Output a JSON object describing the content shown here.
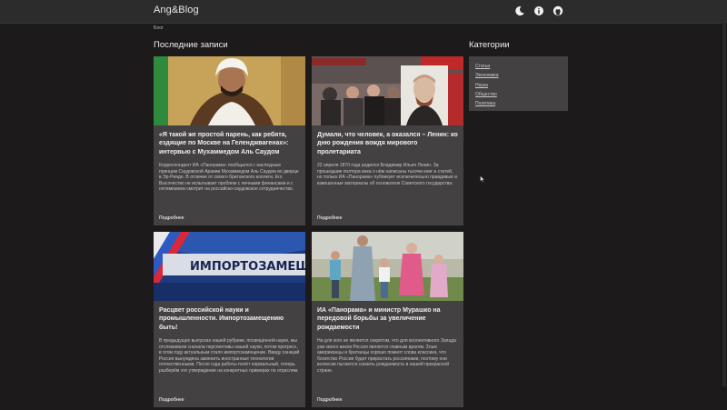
{
  "nav": {
    "brand": "Ang&Blog",
    "icons": [
      "moon-icon",
      "info-icon",
      "github-icon"
    ]
  },
  "breadcrumb": "Блог",
  "main": {
    "title": "Последние записи",
    "more_label": "Подробнее",
    "posts": [
      {
        "title": "«Я такой же простой парень, как ребята, ездящие по Москве на Геленджвагенах»: интервью с Мухаммедом Аль Саудом",
        "excerpt": "Корреспондент ИА «Панорама» пообщался с наследным принцем Саудовской Аравии Мухаммедом Аль Саудом во дворце в Эр-Рияде. В отличие от своего британского коллеги, Его Высочество не испытывает проблем с личными финансами и с оптимизмом смотрит на российско-саудовское сотрудничество.",
        "image": "portrait-photo"
      },
      {
        "title": "Думали, что человек, а оказался – Ленин: ко дню рождения вождя мирового пролетариата",
        "excerpt": "22 апреля 1870 года родился Владимир Ильич Ленин. За прошедшие полтора века о нём написаны тысячи книг и статей, но только ИА «Панорама» публикует исключительно правдивые и взвешенные материалы об основателе Советского государства.",
        "image": "crowd-photo"
      },
      {
        "title": "Расцвет российской науки и промышленности. Импортозамещению быть!",
        "excerpt": "В предыдущих выпусках нашей рубрики, посвящённой науке, мы отслеживали сначала перспективы нашей науки, потом прогресс, в этом году актуальным стало импортозамещение. Ввиду санкций Россия вынуждена заменить иностранные технологии отечественными. После года работы полёт нормальный, теперь разберём это утверждение на конкретных примерах по отраслям.",
        "image": "banner-photo",
        "banner_text": "ИМПОРТОЗАМЕЩЕНИ"
      },
      {
        "title": "ИА «Панорама» и министр Мурашко на передовой борьбы за увеличение рождаемости",
        "excerpt": "Ни для кого не является секретом, что для коллективного Запада уже много веков Россия является главным врагом. Злые американцы и британцы хорошо помнят слова классика, что богатство России будет прирастать россиянами, поэтому они всячески пытаются снизить рождаемость в нашей прекрасной стране.",
        "image": "family-photo"
      }
    ]
  },
  "sidebar": {
    "title": "Категории",
    "categories": [
      "Статьи",
      "Экономика",
      "Наука",
      "Общество",
      "Политика"
    ]
  }
}
